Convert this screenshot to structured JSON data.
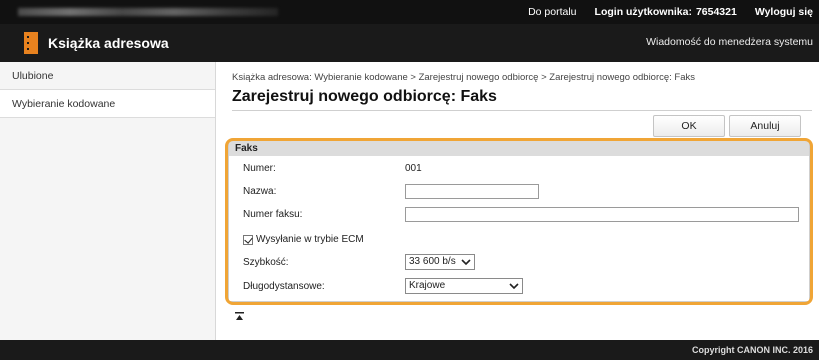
{
  "topbar": {
    "portal_link": "Do portalu",
    "login_label": "Login użytkownika:",
    "login_value": "7654321",
    "logout_link": "Wyloguj się"
  },
  "header": {
    "title": "Książka adresowa",
    "message_link": "Wiadomość do menedżera systemu",
    "accent_color": "#e8821f"
  },
  "sidebar": {
    "items": [
      {
        "label": "Ulubione"
      },
      {
        "label": "Wybieranie kodowane"
      }
    ]
  },
  "main": {
    "breadcrumb": "Książka adresowa: Wybieranie kodowane > Zarejestruj nowego odbiorcę > Zarejestruj nowego odbiorcę: Faks",
    "title": "Zarejestruj nowego odbiorcę: Faks",
    "ok_label": "OK",
    "cancel_label": "Anuluj"
  },
  "form": {
    "section_title": "Faks",
    "number_label": "Numer:",
    "number_value": "001",
    "name_label": "Nazwa:",
    "name_value": "",
    "fax_label": "Numer faksu:",
    "fax_value": "",
    "ecm_label": "Wysyłanie w trybie ECM",
    "ecm_checked": true,
    "speed_label": "Szybkość:",
    "speed_value": "33 600 b/s",
    "distance_label": "Długodystansowe:",
    "distance_value": "Krajowe",
    "highlight_color": "#f0a536"
  },
  "footer": {
    "copyright": "Copyright CANON INC. 2016"
  }
}
